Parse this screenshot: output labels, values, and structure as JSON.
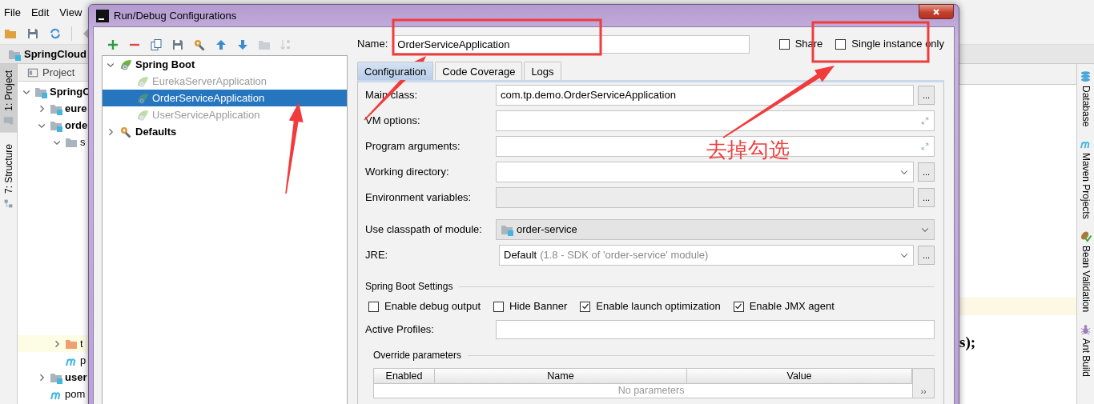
{
  "ide": {
    "menu": [
      {
        "label": "File"
      },
      {
        "label": "Edit"
      },
      {
        "label": "View"
      }
    ],
    "toolbar": [
      {
        "kind": "open"
      },
      {
        "kind": "save"
      },
      {
        "kind": "sync"
      },
      {
        "kind": "back"
      }
    ],
    "breadcrumb": "SpringCloud",
    "left_tool_windows": [
      {
        "label": "1: Project",
        "kind": "project",
        "selected": true
      },
      {
        "label": "7: Structure",
        "kind": "structure",
        "selected": false
      }
    ],
    "project_panel": {
      "title": "Project",
      "tree": [
        {
          "label": "SpringC",
          "kind": "module",
          "expanded": true,
          "children": [
            {
              "label": "eure",
              "kind": "module",
              "expanded": false
            },
            {
              "label": "orde",
              "kind": "module",
              "expanded": true,
              "children": [
                {
                  "label": "s",
                  "kind": "folder",
                  "expanded": true
                },
                {
                  "label": "t",
                  "kind": "excluded-folder",
                  "expanded": false,
                  "highlighted": true
                },
                {
                  "label": "p",
                  "kind": "pom"
                }
              ]
            },
            {
              "label": "user",
              "kind": "module",
              "expanded": false
            },
            {
              "label": "pom",
              "kind": "pom"
            }
          ]
        }
      ]
    },
    "editor": {
      "code_line": "s);"
    },
    "right_tool_windows": [
      {
        "label": "Database",
        "kind": "database"
      },
      {
        "label": "Maven Projects",
        "kind": "maven"
      },
      {
        "label": "Bean Validation",
        "kind": "bean"
      },
      {
        "label": "Ant Build",
        "kind": "ant"
      }
    ]
  },
  "dialog": {
    "title": "Run/Debug Configurations",
    "toolbar": [
      {
        "kind": "add",
        "disabled": false
      },
      {
        "kind": "remove",
        "disabled": false
      },
      {
        "kind": "copy",
        "disabled": false
      },
      {
        "kind": "save",
        "disabled": false
      },
      {
        "kind": "wrench",
        "disabled": false
      },
      {
        "kind": "up",
        "disabled": false
      },
      {
        "kind": "down",
        "disabled": false
      },
      {
        "kind": "folder",
        "disabled": true
      },
      {
        "kind": "sort",
        "disabled": true
      }
    ],
    "config_tree": [
      {
        "label": "Spring Boot",
        "kind": "group",
        "expanded": true,
        "children": [
          {
            "label": "EurekaServerApplication",
            "temporary": true,
            "selected": false
          },
          {
            "label": "OrderServiceApplication",
            "temporary": true,
            "selected": true
          },
          {
            "label": "UserServiceApplication",
            "temporary": true,
            "selected": false
          }
        ]
      },
      {
        "label": "Defaults",
        "kind": "defaults",
        "expanded": false
      }
    ],
    "name": {
      "label": "Name:",
      "value": "OrderServiceApplication"
    },
    "options": [
      {
        "label": "Share",
        "checked": false
      },
      {
        "label": "Single instance only",
        "checked": false
      }
    ],
    "tabs": [
      {
        "label": "Configuration",
        "selected": true
      },
      {
        "label": "Code Coverage",
        "selected": false
      },
      {
        "label": "Logs",
        "selected": false
      }
    ],
    "fields": [
      {
        "label": "Main class:",
        "kind": "text",
        "value": "com.tp.demo.OrderServiceApplication",
        "button": "..."
      },
      {
        "label": "VM options:",
        "kind": "expand"
      },
      {
        "label": "Program arguments:",
        "kind": "expand"
      },
      {
        "label": "Working directory:",
        "kind": "combo",
        "button": "..."
      },
      {
        "label": "Environment variables:",
        "kind": "readonly",
        "button": "..."
      },
      {
        "label": "Use classpath of module:",
        "kind": "module",
        "value": "order-service"
      },
      {
        "label": "JRE:",
        "kind": "jre",
        "value": "Default",
        "detail": "(1.8 - SDK of 'order-service' module)",
        "button": "..."
      }
    ],
    "spring_boot_settings": {
      "title": "Spring Boot Settings",
      "checkboxes": [
        {
          "label": "Enable debug output",
          "checked": false
        },
        {
          "label": "Hide Banner",
          "checked": false
        },
        {
          "label": "Enable launch optimization",
          "checked": true
        },
        {
          "label": "Enable JMX agent",
          "checked": true
        }
      ],
      "active_profiles": {
        "label": "Active Profiles:"
      }
    },
    "override_parameters": {
      "title": "Override parameters",
      "columns": [
        "Enabled",
        "Name",
        "Value"
      ],
      "empty_text": "No parameters",
      "side_button": "››"
    }
  },
  "annotations": [
    {
      "kind": "box"
    },
    {
      "kind": "box"
    },
    {
      "kind": "arrow"
    },
    {
      "kind": "arrow"
    },
    {
      "kind": "arrow"
    },
    {
      "kind": "note",
      "text": "去掉勾选"
    }
  ]
}
